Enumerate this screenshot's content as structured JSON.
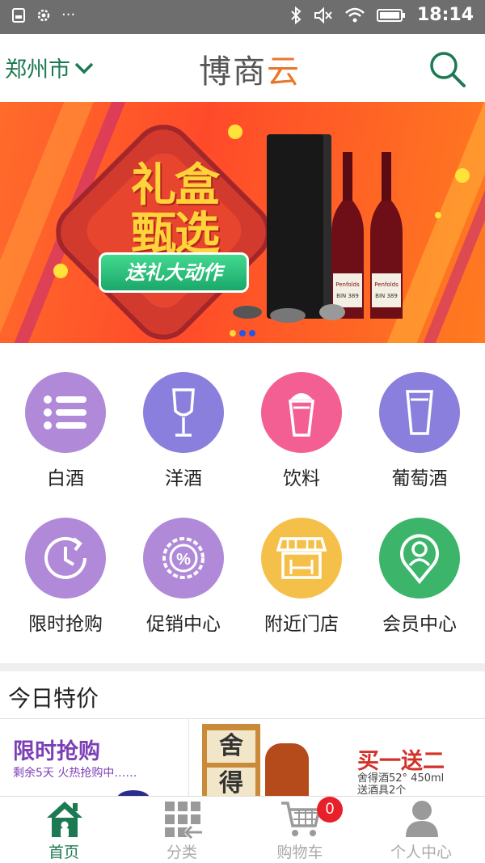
{
  "statusbar": {
    "time": "18:14",
    "left_icons": [
      "storage-icon",
      "settings-gear-icon",
      "more-dots-icon"
    ],
    "right_icons": [
      "bluetooth-icon",
      "mute-icon",
      "wifi-icon",
      "battery-icon"
    ]
  },
  "header": {
    "city": "郑州市",
    "logo_text_1": "博商",
    "logo_text_2": "云",
    "brand_color": "#1c7a52",
    "accent_color": "#e9772b"
  },
  "banner": {
    "title": "礼盒甄选",
    "subtitle": "送礼大动作",
    "bottle_label_1": "Penfolds",
    "bottle_label_2": "BIN 389",
    "slides": 3,
    "active_slide": 1
  },
  "categories": [
    {
      "label": "白酒",
      "icon": "list-icon",
      "color": "#b08ad8"
    },
    {
      "label": "洋酒",
      "icon": "wine-glass-icon",
      "color": "#8a7fdc"
    },
    {
      "label": "饮料",
      "icon": "drink-cup-icon",
      "color": "#f35f93"
    },
    {
      "label": "葡萄酒",
      "icon": "tumbler-icon",
      "color": "#8a7fdc"
    },
    {
      "label": "限时抢购",
      "icon": "clock-icon",
      "color": "#b08ad8"
    },
    {
      "label": "促销中心",
      "icon": "percent-badge-icon",
      "color": "#b08ad8"
    },
    {
      "label": "附近门店",
      "icon": "store-icon",
      "color": "#f5c04a"
    },
    {
      "label": "会员中心",
      "icon": "member-pin-icon",
      "color": "#3cb56a"
    }
  ],
  "today": {
    "title": "今日特价",
    "flash": {
      "title": "限时抢购",
      "subtitle": "剩余5天 火热抢购中……"
    },
    "deal": {
      "title": "买一送二",
      "desc_line1": "舍得酒52° 450ml",
      "desc_line2": "送酒具2个",
      "box_char_1": "舍",
      "box_char_2": "得"
    }
  },
  "bottomnav": {
    "items": [
      {
        "label": "首页",
        "icon": "home-icon",
        "active": true
      },
      {
        "label": "分类",
        "icon": "category-grid-icon",
        "active": false
      },
      {
        "label": "购物车",
        "icon": "cart-icon",
        "active": false
      },
      {
        "label": "个人中心",
        "icon": "user-icon",
        "active": false
      }
    ],
    "cart_count": "0"
  }
}
